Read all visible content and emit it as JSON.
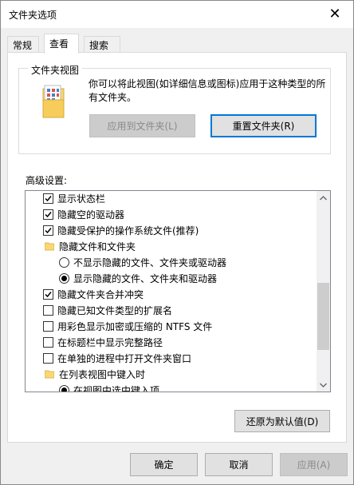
{
  "window": {
    "title": "文件夹选项",
    "close_glyph": "✕"
  },
  "tabs": [
    {
      "label": "常规",
      "active": false
    },
    {
      "label": "查看",
      "active": true
    },
    {
      "label": "搜索",
      "active": false
    }
  ],
  "folder_views": {
    "title": "文件夹视图",
    "description": "你可以将此视图(如详细信息或图标)应用于这种类型的所有文件夹。",
    "apply_button": "应用到文件夹(L)",
    "reset_button": "重置文件夹(R)"
  },
  "advanced": {
    "label": "高级设置:",
    "items": [
      {
        "type": "checkbox",
        "checked": true,
        "label": "显示状态栏"
      },
      {
        "type": "checkbox",
        "checked": true,
        "label": "隐藏空的驱动器"
      },
      {
        "type": "checkbox",
        "checked": true,
        "label": "隐藏受保护的操作系统文件(推荐)"
      },
      {
        "type": "folder",
        "label": "隐藏文件和文件夹"
      },
      {
        "type": "radio",
        "checked": false,
        "label": "不显示隐藏的文件、文件夹或驱动器"
      },
      {
        "type": "radio",
        "checked": true,
        "label": "显示隐藏的文件、文件夹和驱动器"
      },
      {
        "type": "checkbox",
        "checked": true,
        "label": "隐藏文件夹合并冲突"
      },
      {
        "type": "checkbox",
        "checked": false,
        "label": "隐藏已知文件类型的扩展名"
      },
      {
        "type": "checkbox",
        "checked": false,
        "label": "用彩色显示加密或压缩的 NTFS 文件"
      },
      {
        "type": "checkbox",
        "checked": false,
        "label": "在标题栏中显示完整路径"
      },
      {
        "type": "checkbox",
        "checked": false,
        "label": "在单独的进程中打开文件夹窗口"
      },
      {
        "type": "folder",
        "label": "在列表视图中键入时"
      },
      {
        "type": "radio",
        "checked": true,
        "label": "在视图中选中键入项"
      }
    ]
  },
  "restore_button": "还原为默认值(D)",
  "footer": {
    "ok": "确定",
    "cancel": "取消",
    "apply": "应用(A)"
  },
  "colors": {
    "accent": "#0078d7",
    "folder_yellow": "#f8d775"
  }
}
